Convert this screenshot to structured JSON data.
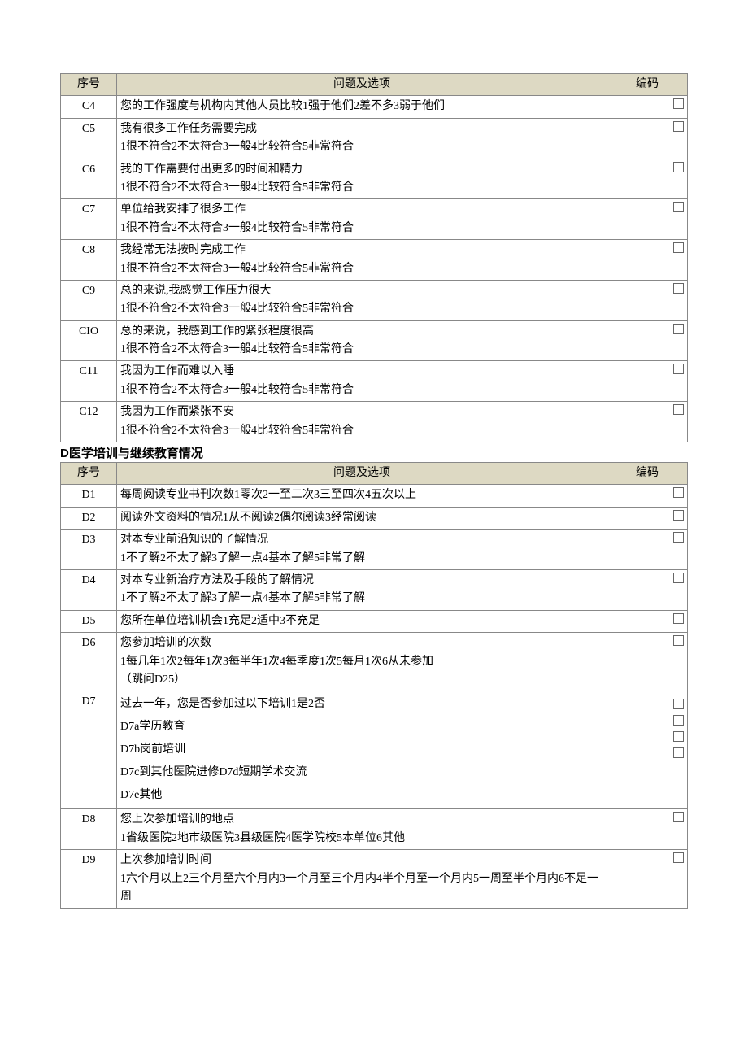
{
  "tableC": {
    "headers": {
      "seq": "序号",
      "question": "问题及选项",
      "code": "编码"
    },
    "rows": [
      {
        "id": "C4",
        "lines": [
          "",
          "您的工作强度与机构内其他人员比较1强于他们2差不多3弱于他们"
        ]
      },
      {
        "id": "C5",
        "lines": [
          "我有很多工作任务需要完成",
          "1很不符合2不太符合3一般4比较符合5非常符合"
        ]
      },
      {
        "id": "C6",
        "lines": [
          "我的工作需要付出更多的时间和精力",
          "1很不符合2不太符合3一般4比较符合5非常符合"
        ]
      },
      {
        "id": "C7",
        "lines": [
          "单位给我安排了很多工作",
          "1很不符合2不太符合3一般4比较符合5非常符合"
        ]
      },
      {
        "id": "C8",
        "lines": [
          "我经常无法按时完成工作",
          "1很不符合2不太符合3一般4比较符合5非常符合"
        ]
      },
      {
        "id": "C9",
        "lines": [
          "总的来说,我感觉工作压力很大",
          "1很不符合2不太符合3一般4比较符合5非常符合"
        ]
      },
      {
        "id": "CIO",
        "lines": [
          "总的来说，我感到工作的紧张程度很高",
          "1很不符合2不太符合3一般4比较符合5非常符合"
        ]
      },
      {
        "id": "C11",
        "lines": [
          "我因为工作而难以入睡",
          "1很不符合2不太符合3一般4比较符合5非常符合"
        ]
      },
      {
        "id": "C12",
        "lines": [
          "我因为工作而紧张不安",
          "1很不符合2不太符合3一般4比较符合5非常符合"
        ]
      }
    ]
  },
  "sectionD_title": "D医学培训与继续教育情况",
  "tableD": {
    "headers": {
      "seq": "序号",
      "question": "问题及选项",
      "code": "编码"
    },
    "rows": [
      {
        "id": "D1",
        "lines": [
          "每周阅读专业书刊次数1零次2一至二次3三至四次4五次以上"
        ],
        "boxes": 1
      },
      {
        "id": "D2",
        "lines": [
          "阅读外文资料的情况1从不阅读2偶尔阅读3经常阅读"
        ],
        "boxes": 1
      },
      {
        "id": "D3",
        "lines": [
          "对本专业前沿知识的了解情况",
          "1不了解2不太了解3了解一点4基本了解5非常了解"
        ],
        "boxes": 1
      },
      {
        "id": "D4",
        "lines": [
          "对本专业新治疗方法及手段的了解情况",
          "1不了解2不太了解3了解一点4基本了解5非常了解"
        ],
        "boxes": 1
      },
      {
        "id": "D5",
        "lines": [
          "您所在单位培训机会1充足2适中3不充足"
        ],
        "boxes": 1
      },
      {
        "id": "D6",
        "lines": [
          "您参加培训的次数",
          "1每几年1次2每年1次3每半年1次4每季度1次5每月1次6从未参加",
          "（跳问D25）"
        ],
        "boxes": 1
      },
      {
        "id": "D7",
        "lines": [
          "过去一年，您是否参加过以下培训1是2否",
          "D7a学历教育",
          "D7b岗前培训",
          "D7c到其他医院进修D7d短期学术交流",
          "D7e其他"
        ],
        "boxes": 4,
        "multi": true
      },
      {
        "id": "D8",
        "lines": [
          "您上次参加培训的地点",
          "1省级医院2地市级医院3县级医院4医学院校5本单位6其他"
        ],
        "boxes": 1
      },
      {
        "id": "D9",
        "lines": [
          "上次参加培训时间",
          "1六个月以上2三个月至六个月内3一个月至三个月内4半个月至一个月内5一周至半个月内6不足一周"
        ],
        "boxes": 1
      }
    ]
  }
}
